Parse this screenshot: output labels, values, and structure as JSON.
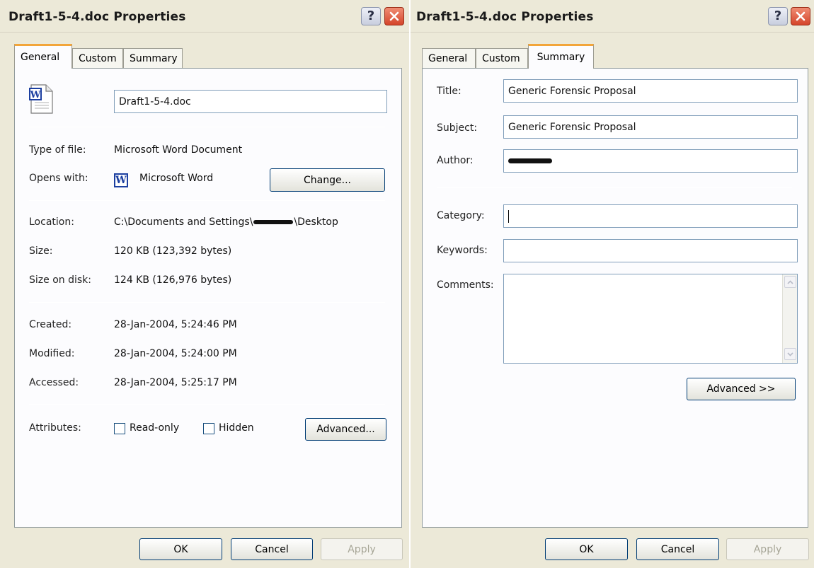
{
  "left_dialog": {
    "title": "Draft1-5-4.doc Properties",
    "help_label": "?",
    "tabs": [
      "General",
      "Custom",
      "Summary"
    ],
    "active_tab": "General",
    "file_name": "Draft1-5-4.doc",
    "type_of_file": {
      "label": "Type of file:",
      "value": "Microsoft Word Document"
    },
    "opens_with": {
      "label": "Opens with:",
      "value": "Microsoft Word",
      "button": "Change..."
    },
    "location": {
      "label": "Location:",
      "value_prefix": "C:\\Documents and Settings\\",
      "value_suffix": "\\Desktop"
    },
    "size": {
      "label": "Size:",
      "value": "120 KB (123,392 bytes)"
    },
    "size_on_disk": {
      "label": "Size on disk:",
      "value": "124 KB (126,976 bytes)"
    },
    "created": {
      "label": "Created:",
      "value": "28-Jan-2004, 5:24:46 PM"
    },
    "modified": {
      "label": "Modified:",
      "value": "28-Jan-2004, 5:24:00 PM"
    },
    "accessed": {
      "label": "Accessed:",
      "value": "28-Jan-2004, 5:25:17 PM"
    },
    "attributes": {
      "label": "Attributes:",
      "read_only": "Read-only",
      "hidden": "Hidden",
      "button": "Advanced..."
    },
    "buttons": {
      "ok": "OK",
      "cancel": "Cancel",
      "apply": "Apply"
    }
  },
  "right_dialog": {
    "title": "Draft1-5-4.doc Properties",
    "help_label": "?",
    "tabs": [
      "General",
      "Custom",
      "Summary"
    ],
    "active_tab": "Summary",
    "fields": {
      "title": {
        "label": "Title:",
        "value": "Generic Forensic Proposal"
      },
      "subject": {
        "label": "Subject:",
        "value": "Generic Forensic Proposal"
      },
      "author": {
        "label": "Author:",
        "value": ""
      },
      "category": {
        "label": "Category:",
        "value": ""
      },
      "keywords": {
        "label": "Keywords:",
        "value": ""
      },
      "comments": {
        "label": "Comments:",
        "value": ""
      }
    },
    "advanced_button": "Advanced >>",
    "buttons": {
      "ok": "OK",
      "cancel": "Cancel",
      "apply": "Apply"
    }
  },
  "colors": {
    "dialog_bg": "#ece9d8",
    "panel_bg": "#fcfcfe",
    "active_tab_accent": "#f2a53a",
    "close_button": "#d4442a",
    "textbox_border": "#7f9db9",
    "button_border": "#003c74",
    "word_blue": "#1c3fa0"
  },
  "icons": {
    "document": "word-document-icon",
    "app": "word-app-icon",
    "help": "help-icon",
    "close": "close-icon"
  }
}
